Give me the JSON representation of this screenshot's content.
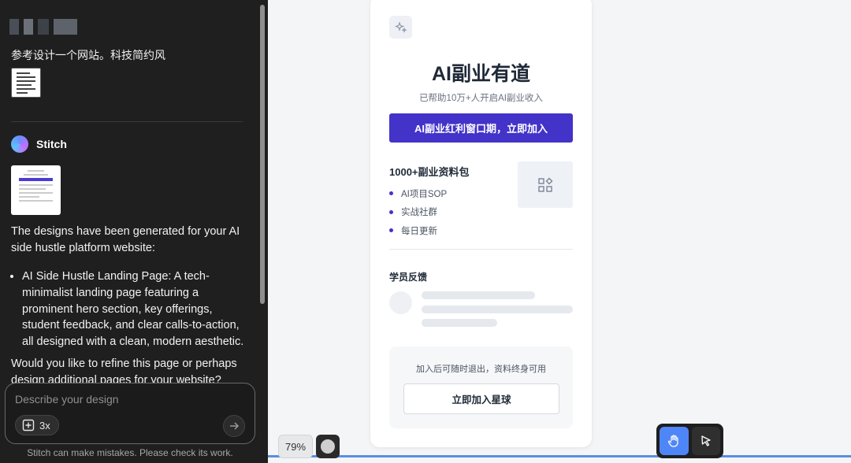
{
  "chat": {
    "user_message": "参考设计一个网站。科技简约风",
    "assistant_name": "Stitch",
    "response_intro": "The designs have been generated for your AI side hustle platform website:",
    "response_bullets": [
      "AI Side Hustle Landing Page: A tech-minimalist landing page featuring a prominent hero section, key offerings, student feedback, and clear calls-to-action, all designed with a clean, modern aesthetic."
    ],
    "response_followup": "Would you like to refine this page or perhaps design additional pages for your website?",
    "composer": {
      "placeholder": "Describe your design",
      "attach_count": "3x"
    },
    "disclaimer": "Stitch can make mistakes. Please check its work."
  },
  "preview": {
    "hero_title": "AI副业有道",
    "hero_subtitle": "已帮助10万+人开启AI副业收入",
    "cta_primary": "AI副业红利窗口期，立即加入",
    "pack_title": "1000+副业资料包",
    "pack_items": [
      "AI项目SOP",
      "实战社群",
      "每日更新"
    ],
    "feedback_title": "学员反馈",
    "join_note": "加入后可随时退出，资料终身可用",
    "join_button": "立即加入星球",
    "accent_color": "#4333c9"
  },
  "canvas_controls": {
    "zoom": "79%",
    "tools": [
      "hand-tool",
      "select-tool"
    ],
    "active_tool": "hand-tool",
    "active_color": "#4f86f7"
  }
}
